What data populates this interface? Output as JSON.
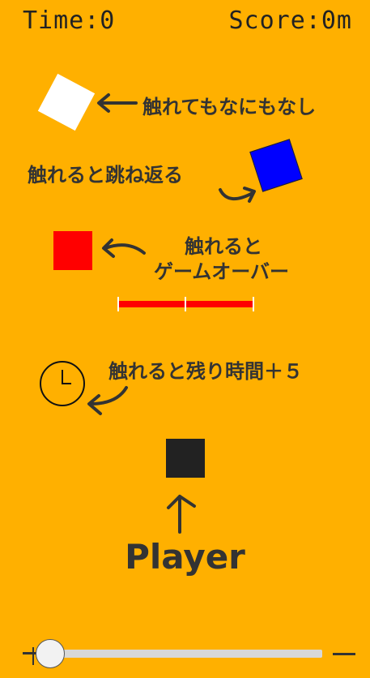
{
  "hud": {
    "time": "Time:0",
    "score": "Score:0m"
  },
  "legend": {
    "white": "触れてもなにもなし",
    "blue": "触れると跳ね返る",
    "red_line1": "触れると",
    "red_line2": "ゲームオーバー",
    "clock": "触れると残り時間＋５"
  },
  "player_label": "Player",
  "slider": {
    "value": 0
  },
  "colors": {
    "background": "#FFB000",
    "white_block": "#FFFFFF",
    "blue_block": "#0000FF",
    "red_block": "#FF0000",
    "player_block": "#222222"
  }
}
